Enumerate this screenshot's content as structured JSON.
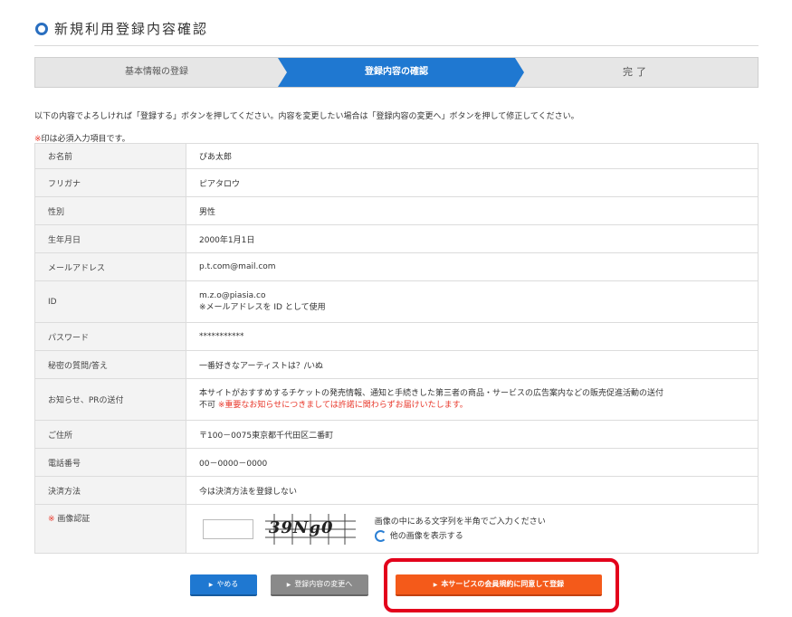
{
  "page": {
    "title": "新規利用登録内容確認"
  },
  "steps": [
    {
      "label": "基本情報の登録"
    },
    {
      "label": "登録内容の確認"
    },
    {
      "label": "完了"
    }
  ],
  "intro": "以下の内容でよろしければ「登録する」ボタンを押してください。内容を変更したい場合は「登録内容の変更へ」ボタンを押して修正してください。",
  "note": {
    "mark": "※",
    "text": "印は必須入力項目です。"
  },
  "form": {
    "rows": [
      {
        "label": "お名前",
        "value": "ぴあ太郎"
      },
      {
        "label": "フリガナ",
        "value": "ピアタロウ"
      },
      {
        "label": "性別",
        "value": "男性"
      },
      {
        "label": "生年月日",
        "value": "2000年1月1日"
      },
      {
        "label": "メールアドレス",
        "value": "p.t.com@mail.com"
      },
      {
        "label": "ID",
        "value": "m.z.o@piasia.co",
        "value2": "※メールアドレスを ID として使用"
      },
      {
        "label": "パスワード",
        "value": "***********"
      },
      {
        "label": "秘密の質問/答え",
        "value": "一番好きなアーティストは？/いぬ"
      },
      {
        "label": "お知らせ、PRの送付",
        "value": "本サイトがおすすめするチケットの発売情報、通知と手続きした第三者の商品・サービスの広告案内などの販売促進活動の送付",
        "value2a": "不可",
        "value2b": "※重要なお知らせにつきましては許諾に関わらずお届けいたします。"
      },
      {
        "label": "ご住所",
        "value": "〒100－0075東京都千代田区二番町"
      },
      {
        "label": "電話番号",
        "value": "00－0000－0000"
      },
      {
        "label": "決済方法",
        "value": "今は決済方法を登録しない"
      }
    ],
    "captcha": {
      "mark": "※",
      "label": "画像認証",
      "image_text": "39Ng0",
      "help": "画像の中にある文字列を半角でご入力ください",
      "refresh": "他の画像を表示する"
    }
  },
  "buttons": {
    "arrow": "▶",
    "cancel": "やめる",
    "back": "登録内容の変更へ",
    "register": "本サービスの会員規約に同意して登録"
  },
  "colors": {
    "accent": "#1f78d1",
    "register": "#f45a1a",
    "required": "#e8372a",
    "highlight": "#e3001b"
  }
}
